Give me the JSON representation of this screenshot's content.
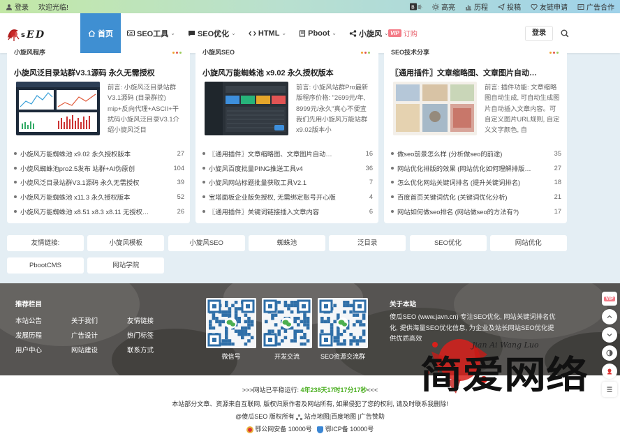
{
  "topbar": {
    "login": "登录",
    "welcome": "欢迎光临!",
    "right_items": [
      "高亮",
      "历程",
      "投稿",
      "友链申请",
      "广告合作"
    ]
  },
  "header": {
    "nav": [
      {
        "label": "首页",
        "icon": "home-icon",
        "active": true
      },
      {
        "label": "SEO工具",
        "icon": "keyboard-icon",
        "caret": true
      },
      {
        "label": "SEO优化",
        "icon": "chat-icon",
        "caret": true
      },
      {
        "label": "HTML",
        "icon": "code-icon",
        "caret": true
      },
      {
        "label": "Pboot",
        "icon": "book-icon",
        "caret": true
      },
      {
        "label": "小旋风",
        "icon": "share-icon",
        "caret": true
      }
    ],
    "vip_badge": "VIP",
    "order": "订购",
    "login_button": "登录"
  },
  "cards": [
    {
      "heading": "小旋风程序",
      "title": "小旋风泛目录站群V3.1源码 永久无需授权",
      "desc": "前言: 小旋风泛目录站群V3.1源码 (目录群控) mip+反向代理+ASCII+干扰码小旋风泛目录V3.1介绍小旋风泛目",
      "items": [
        {
          "t": "小旋风万能蜘蛛池 x9.02 永久授权版本",
          "n": "27"
        },
        {
          "t": "小旋风蜘蛛池pro2.5发布 站群+AI伪原创",
          "n": "104"
        },
        {
          "t": "小旋风泛目录站群V3.1源码 永久无需授权",
          "n": "39"
        },
        {
          "t": "小旋风万能蜘蛛池 x11.3 永久授权版本",
          "n": "52"
        },
        {
          "t": "小旋风万能蜘蛛池 x8.51 x8.3 x8.11 无授权…",
          "n": "26"
        }
      ]
    },
    {
      "heading": "小旋风SEO",
      "title": "小旋风万能蜘蛛池 x9.02 永久授权版本",
      "desc": "前言: 小旋风站群Pro最新版程序价格: \"2699元/年, 8999元/永久\"真心不便宜我们先用小旋风万能站群x9.02版本小",
      "items": [
        {
          "t": "〖通用插件〗文章缩略图、文章图片自动…",
          "n": "16"
        },
        {
          "t": "小旋风百度批量PING推送工具v4",
          "n": "36"
        },
        {
          "t": "小旋风网站标题批量获取工具V2.1",
          "n": "7"
        },
        {
          "t": "宝塔面板企业版免授权, 无需绑定账号开心版",
          "n": "4"
        },
        {
          "t": "〖通用插件〗关键词链接插入文章内容",
          "n": "6"
        }
      ]
    },
    {
      "heading": "SEO技术分享",
      "title": "〖通用插件〗文章缩略图、文章图片自动…",
      "desc": "前言: 插件功能: 文章缩略图自动生成, 可自动生成图片自动插入文章内容。可自定义图片URL规则, 自定义文字颜色, 自",
      "items": [
        {
          "t": "做seo前景怎么样 (分析做seo的前途)",
          "n": "35"
        },
        {
          "t": "网站优化排版的效果 (网站优化如何理解排版…",
          "n": "27"
        },
        {
          "t": "怎么优化网站关键词排名 (提升关键词排名)",
          "n": "18"
        },
        {
          "t": "百度首页关键词优化 (关键词优化分析)",
          "n": "21"
        },
        {
          "t": "网站如何做seo排名 (网站做seo的方法有?)",
          "n": "17"
        }
      ]
    }
  ],
  "friend_links": {
    "label": "友情链接:",
    "items": [
      "小旋风模板",
      "小旋风SEO",
      "蜘蛛池",
      "泛目录",
      "SEO优化",
      "网站优化",
      "PbootCMS",
      "网站学院"
    ]
  },
  "footer": {
    "nav_title": "推荐栏目",
    "nav_links": [
      "本站公告",
      "关于我们",
      "友情链接",
      "发展历程",
      "广告设计",
      "热门标签",
      "用户中心",
      "网站建设",
      "联系方式"
    ],
    "qr_labels": [
      "微信号",
      "开发交流",
      "SEO资源交流群"
    ],
    "about_title": "关于本站",
    "about_text": "傻瓜SEO (www.javn.cn) 专注SEO优化, 网站关键词排名优化, 提供海量SEO优化信息, 为企业及站长网站SEO优化提供优质高效"
  },
  "bottom": {
    "uptime_prefix": ">>>网站已平稳运行: ",
    "uptime_value": "4年238天17时17分17秒",
    "uptime_suffix": "<<<",
    "notice": "本站部分文章、资源来自互联网, 版权归原作者及网站所有, 如果侵犯了您的权利, 请及时联系我删除!",
    "copyright": "@傻瓜SEO 版权所有",
    "links": "站点地图|百度地图 |广告赞助",
    "police": "鄂公网安备 10000号",
    "icp": "鄂ICP备 10000号"
  },
  "watermark": {
    "text": "简爱网络",
    "latin": "Jian Ai Wang Luo"
  },
  "colors": {
    "accent": "#3f8fd2",
    "uptime_green": "#4caf22",
    "vip_pink": "#f47b87"
  }
}
